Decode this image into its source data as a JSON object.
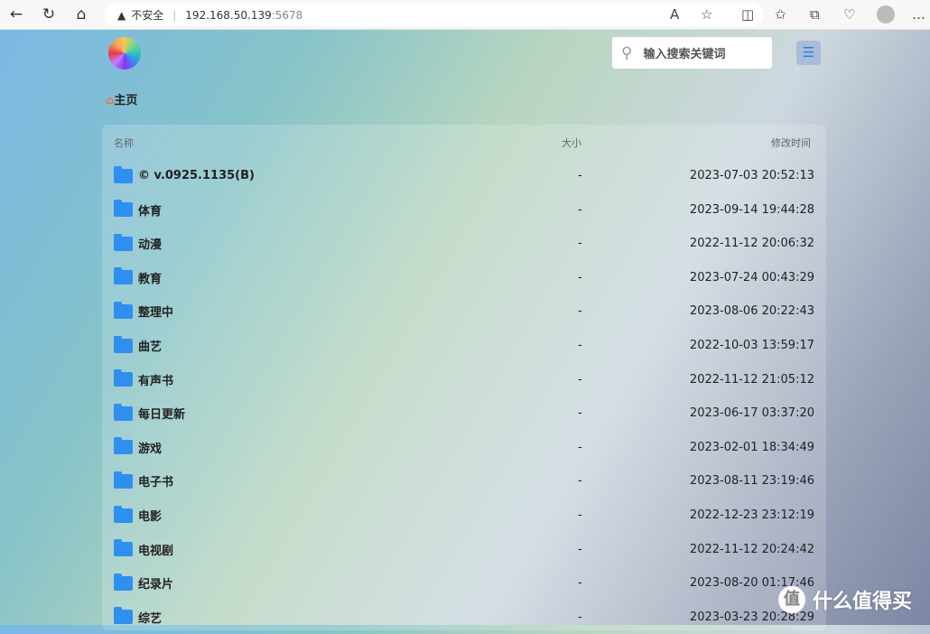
{
  "browser": {
    "security": "不安全",
    "host": "192.168.50.139",
    "port": ":5678"
  },
  "search": {
    "placeholder": "输入搜索关键词"
  },
  "breadcrumb": "主页",
  "columns": {
    "name": "名称",
    "size": "大小",
    "mtime": "修改时间"
  },
  "rows": [
    {
      "name": "© v.0925.1135(B)",
      "size": "-",
      "mtime": "2023-07-03 20:52:13"
    },
    {
      "name": "体育",
      "size": "-",
      "mtime": "2023-09-14 19:44:28"
    },
    {
      "name": "动漫",
      "size": "-",
      "mtime": "2022-11-12 20:06:32"
    },
    {
      "name": "教育",
      "size": "-",
      "mtime": "2023-07-24 00:43:29"
    },
    {
      "name": "整理中",
      "size": "-",
      "mtime": "2023-08-06 20:22:43"
    },
    {
      "name": "曲艺",
      "size": "-",
      "mtime": "2022-10-03 13:59:17"
    },
    {
      "name": "有声书",
      "size": "-",
      "mtime": "2022-11-12 21:05:12"
    },
    {
      "name": "每日更新",
      "size": "-",
      "mtime": "2023-06-17 03:37:20"
    },
    {
      "name": "游戏",
      "size": "-",
      "mtime": "2023-02-01 18:34:49"
    },
    {
      "name": "电子书",
      "size": "-",
      "mtime": "2023-08-11 23:19:46"
    },
    {
      "name": "电影",
      "size": "-",
      "mtime": "2022-12-23 23:12:19"
    },
    {
      "name": "电视剧",
      "size": "-",
      "mtime": "2022-11-12 20:24:42"
    },
    {
      "name": "纪录片",
      "size": "-",
      "mtime": "2023-08-20 01:17:46"
    },
    {
      "name": "综艺",
      "size": "-",
      "mtime": "2023-03-23 20:28:29"
    }
  ],
  "watermark": {
    "badge": "值",
    "text": "什么值得买"
  }
}
